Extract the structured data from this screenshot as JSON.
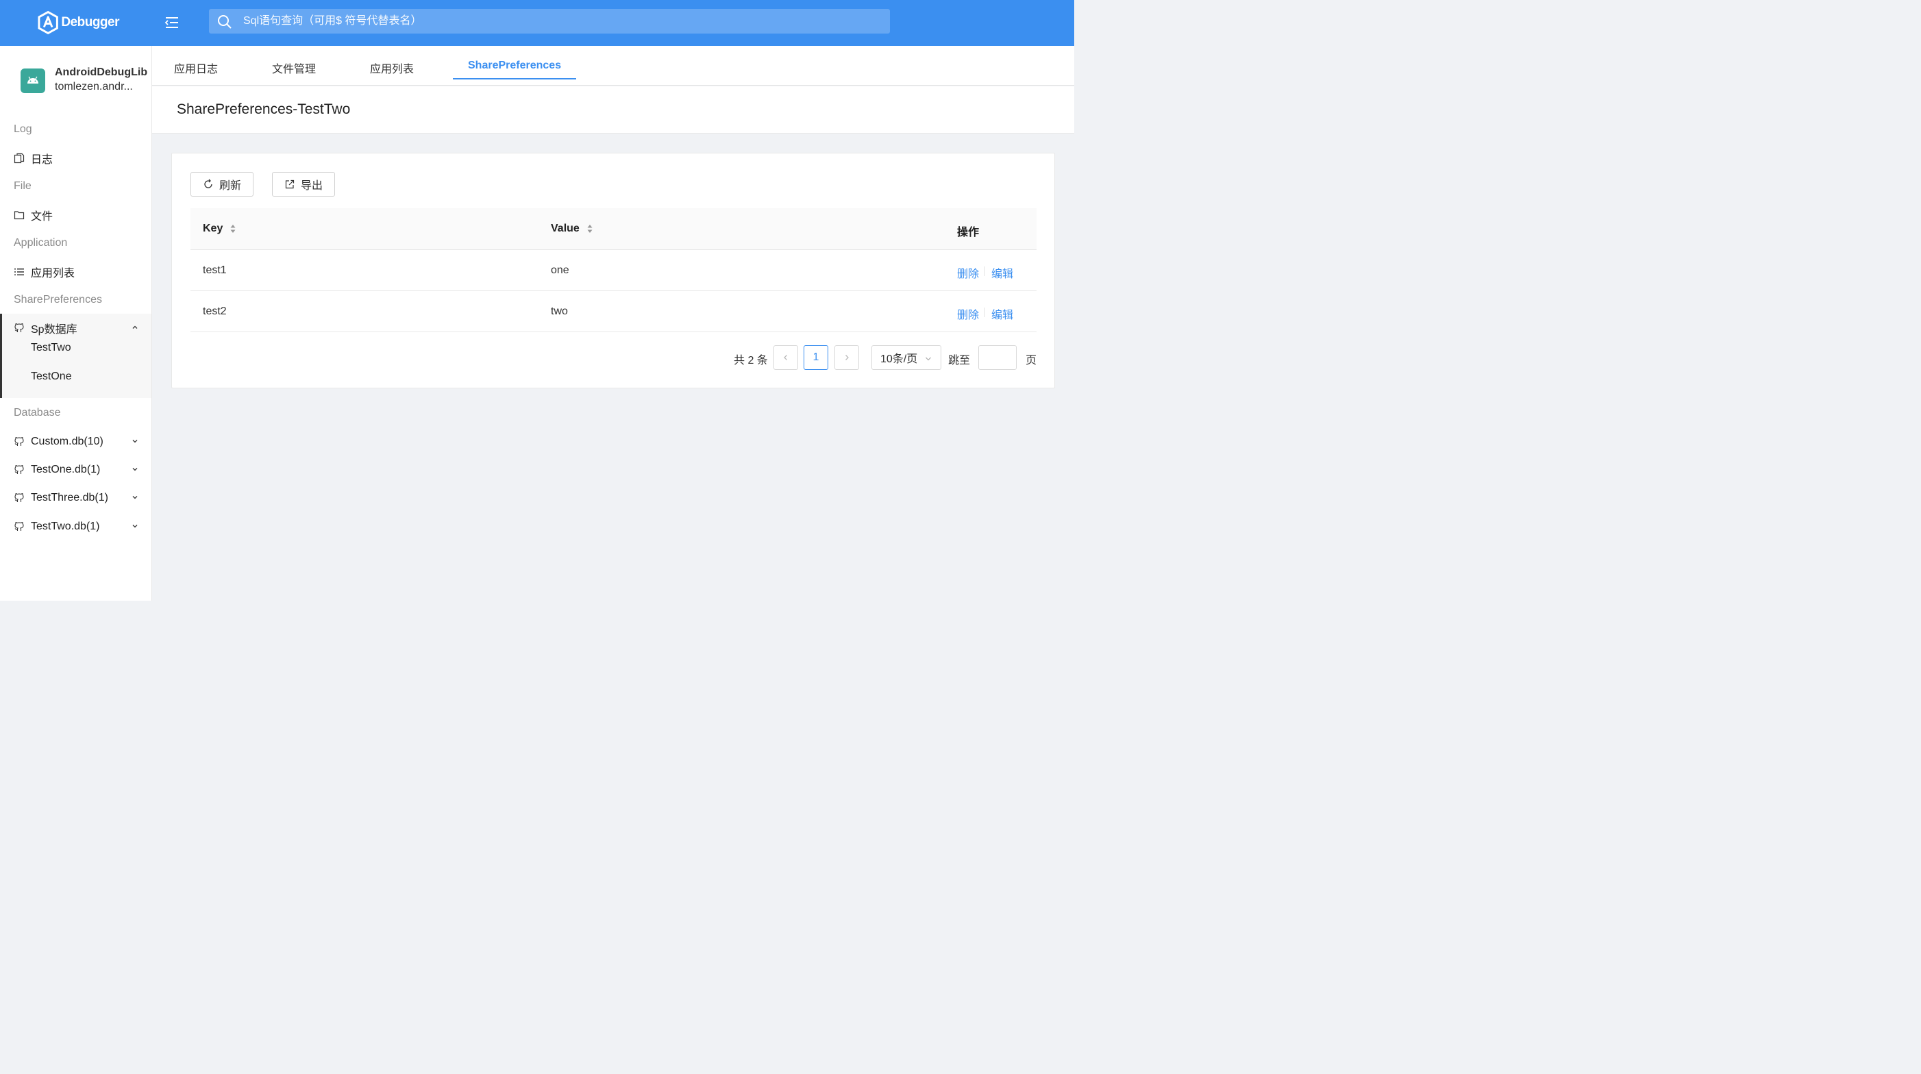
{
  "header": {
    "logo_text": "Debugger",
    "search_placeholder": "Sql语句查询（可用$ 符号代替表名）"
  },
  "sidebar": {
    "app_name": "AndroidDebugLib",
    "app_package": "tomlezen.andr...",
    "groups": {
      "log": "Log",
      "file": "File",
      "application": "Application",
      "sharepreferences": "SharePreferences",
      "database": "Database"
    },
    "items": {
      "log": "日志",
      "file": "文件",
      "app_list": "应用列表",
      "sp_db": "Sp数据库",
      "sp_sub_1": "TestTwo",
      "sp_sub_2": "TestOne",
      "db_1": "Custom.db(10)",
      "db_2": "TestOne.db(1)",
      "db_3": "TestThree.db(1)",
      "db_4": "TestTwo.db(1)"
    }
  },
  "tabs": [
    "应用日志",
    "文件管理",
    "应用列表",
    "SharePreferences"
  ],
  "page_title": "SharePreferences-TestTwo",
  "toolbar": {
    "refresh_label": "刷新",
    "export_label": "导出"
  },
  "table": {
    "columns": [
      "Key",
      "Value",
      "操作"
    ],
    "rows": [
      {
        "key": "test1",
        "value": "one"
      },
      {
        "key": "test2",
        "value": "two"
      }
    ],
    "delete_label": "删除",
    "edit_label": "编辑"
  },
  "pagination": {
    "total_text": "共 2 条",
    "current_page": "1",
    "page_size": "10条/页",
    "jump_label": "跳至",
    "page_label": "页"
  },
  "colors": {
    "primary": "#3b8ff0",
    "app_icon": "#3aa89a"
  }
}
